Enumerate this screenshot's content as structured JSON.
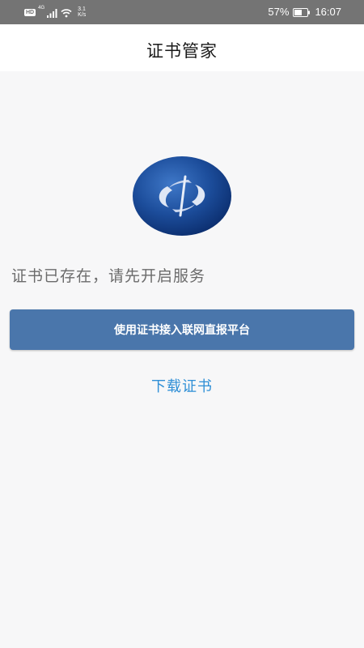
{
  "status_bar": {
    "hd_label": "HD",
    "network_type": "4G",
    "net_speed_value": "3.1",
    "net_speed_unit": "K/s",
    "battery_percent": "57%",
    "time": "16:07",
    "signal_icon": "signal-icon",
    "wifi_icon": "wifi-icon",
    "battery_icon": "battery-icon"
  },
  "header": {
    "title": "证书管家"
  },
  "main": {
    "message": "证书已存在，请先开启服务",
    "primary_button_label": "使用证书接入联网直报平台",
    "download_link_label": "下载证书",
    "accent_color": "#4a76ab",
    "link_color": "#2f8fd6"
  }
}
